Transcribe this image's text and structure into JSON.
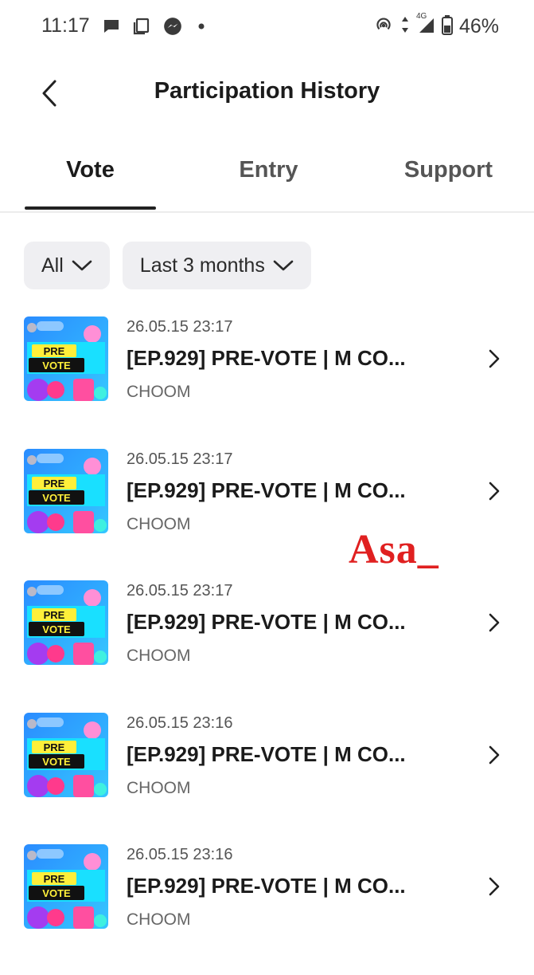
{
  "status_bar": {
    "time": "11:17",
    "battery_percent": "46%",
    "network": "4G"
  },
  "header": {
    "title": "Participation History"
  },
  "tabs": [
    {
      "label": "Vote",
      "active": true
    },
    {
      "label": "Entry",
      "active": false
    },
    {
      "label": "Support",
      "active": false
    }
  ],
  "filters": {
    "type": "All",
    "period": "Last 3 months"
  },
  "items": [
    {
      "date": "26.05.15 23:17",
      "title": "[EP.929] PRE-VOTE | M CO...",
      "artist": "CHOOM",
      "thumb_text": [
        "PRE",
        "VOTE"
      ]
    },
    {
      "date": "26.05.15 23:17",
      "title": "[EP.929] PRE-VOTE | M CO...",
      "artist": "CHOOM",
      "thumb_text": [
        "PRE",
        "VOTE"
      ]
    },
    {
      "date": "26.05.15 23:17",
      "title": "[EP.929] PRE-VOTE | M CO...",
      "artist": "CHOOM",
      "thumb_text": [
        "PRE",
        "VOTE"
      ]
    },
    {
      "date": "26.05.15 23:16",
      "title": "[EP.929] PRE-VOTE | M CO...",
      "artist": "CHOOM",
      "thumb_text": [
        "PRE",
        "VOTE"
      ]
    },
    {
      "date": "26.05.15 23:16",
      "title": "[EP.929] PRE-VOTE | M CO...",
      "artist": "CHOOM",
      "thumb_text": [
        "PRE",
        "VOTE"
      ]
    }
  ],
  "watermark": "Asa_",
  "colors": {
    "accent_text": "#1b1b1b",
    "filter_bg": "#efeff2",
    "watermark": "#e02020"
  }
}
